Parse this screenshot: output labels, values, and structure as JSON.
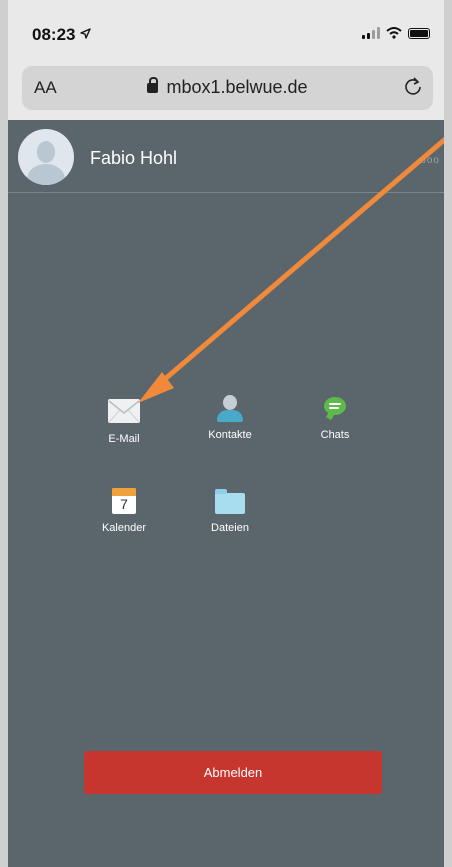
{
  "status_bar": {
    "time": "08:23"
  },
  "browser": {
    "aa_label": "AA",
    "url": "mbox1.belwue.de"
  },
  "header": {
    "username": "Fabio Hohl",
    "more": "ooo"
  },
  "apps": [
    {
      "label": "E-Mail",
      "icon": "mail-icon"
    },
    {
      "label": "Kontakte",
      "icon": "contacts-icon"
    },
    {
      "label": "Chats",
      "icon": "chat-icon"
    },
    {
      "label": "Kalender",
      "icon": "calendar-icon",
      "badge": "7"
    },
    {
      "label": "Dateien",
      "icon": "folder-icon"
    }
  ],
  "logout_label": "Abmelden",
  "colors": {
    "app_bg": "#5b656c",
    "logout": "#c6362f",
    "annotation_arrow": "#f08a3a"
  }
}
